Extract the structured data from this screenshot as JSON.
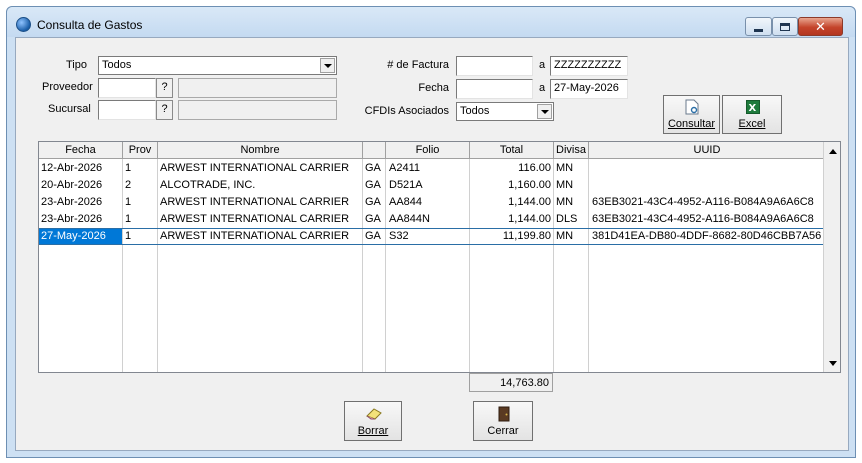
{
  "window": {
    "title": "Consulta de Gastos",
    "close_glyph": "✕",
    "colors": {
      "titlebar": "#c4daf1",
      "close_button": "#c4442b",
      "selection": "#0078d7"
    }
  },
  "filters": {
    "tipo_label": "Tipo",
    "tipo_value": "Todos",
    "proveedor_label": "Proveedor",
    "proveedor_code": "",
    "proveedor_name": "",
    "sucursal_label": "Sucursal",
    "sucursal_code": "",
    "sucursal_name": "",
    "lookup_label": "?",
    "factura_label": "# de Factura",
    "factura_from": "",
    "factura_to": "ZZZZZZZZZZ",
    "range_sep": "a",
    "fecha_label": "Fecha",
    "fecha_from": "",
    "fecha_to": "27-May-2026",
    "cfdis_label": "CFDIs Asociados",
    "cfdis_value": "Todos"
  },
  "buttons": {
    "consultar": "Consultar",
    "excel": "Excel",
    "borrar": "Borrar",
    "cerrar": "Cerrar"
  },
  "icons": {
    "consultar": "document-search-icon",
    "excel": "excel-icon",
    "borrar": "eraser-icon",
    "cerrar": "door-icon"
  },
  "grid": {
    "columns": [
      "Fecha",
      "Prov",
      "Nombre",
      "",
      "Folio",
      "Total",
      "Divisa",
      "UUID"
    ],
    "rows": [
      {
        "fecha": "12-Abr-2026",
        "prov": "1",
        "nombre": "ARWEST INTERNATIONAL CARRIER",
        "tipo": "GA",
        "folio": "A2411",
        "total": "116.00",
        "divisa": "MN",
        "uuid": ""
      },
      {
        "fecha": "20-Abr-2026",
        "prov": "2",
        "nombre": "ALCOTRADE,  INC.",
        "tipo": "GA",
        "folio": "D521A",
        "total": "1,160.00",
        "divisa": "MN",
        "uuid": ""
      },
      {
        "fecha": "23-Abr-2026",
        "prov": "1",
        "nombre": "ARWEST INTERNATIONAL CARRIER",
        "tipo": "GA",
        "folio": "AA844",
        "total": "1,144.00",
        "divisa": "MN",
        "uuid": "63EB3021-43C4-4952-A116-B084A9A6A6C8"
      },
      {
        "fecha": "23-Abr-2026",
        "prov": "1",
        "nombre": "ARWEST INTERNATIONAL CARRIER",
        "tipo": "GA",
        "folio": "AA844N",
        "total": "1,144.00",
        "divisa": "DLS",
        "uuid": "63EB3021-43C4-4952-A116-B084A9A6A6C8"
      },
      {
        "fecha": "27-May-2026",
        "prov": "1",
        "nombre": "ARWEST INTERNATIONAL CARRIER",
        "tipo": "GA",
        "folio": "S32",
        "total": "11,199.80",
        "divisa": "MN",
        "uuid": "381D41EA-DB80-4DDF-8682-80D46CBB7A56"
      }
    ],
    "selected_row": 4,
    "grand_total": "14,763.80"
  }
}
